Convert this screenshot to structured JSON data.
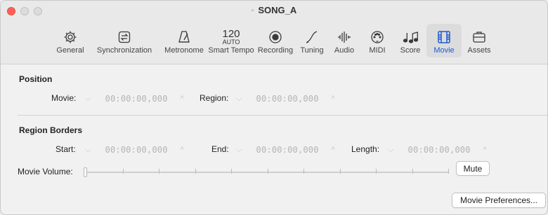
{
  "window": {
    "title": "SONG_A"
  },
  "tabs": [
    {
      "id": "general",
      "label": "General",
      "icon": "gear-icon"
    },
    {
      "id": "synchronization",
      "label": "Synchronization",
      "icon": "sync-icon"
    },
    {
      "id": "metronome",
      "label": "Metronome",
      "icon": "metronome-icon"
    },
    {
      "id": "smart-tempo",
      "label": "Smart Tempo",
      "icon_text_top": "120",
      "icon_text_mid": "AUTO"
    },
    {
      "id": "recording",
      "label": "Recording",
      "icon": "record-icon"
    },
    {
      "id": "tuning",
      "label": "Tuning",
      "icon": "tuning-icon"
    },
    {
      "id": "audio",
      "label": "Audio",
      "icon": "waveform-icon"
    },
    {
      "id": "midi",
      "label": "MIDI",
      "icon": "midi-icon"
    },
    {
      "id": "score",
      "label": "Score",
      "icon": "notes-icon"
    },
    {
      "id": "movie",
      "label": "Movie",
      "icon": "film-icon",
      "active": true
    },
    {
      "id": "assets",
      "label": "Assets",
      "icon": "briefcase-icon"
    }
  ],
  "position": {
    "title": "Position",
    "movie_label": "Movie:",
    "movie_value": "00:00:00,000",
    "region_label": "Region:",
    "region_value": "00:00:00,000"
  },
  "region_borders": {
    "title": "Region Borders",
    "start_label": "Start:",
    "start_value": "00:00:00,000",
    "end_label": "End:",
    "end_value": "00:00:00,000",
    "length_label": "Length:",
    "length_value": "00:00:00,000"
  },
  "movie_volume": {
    "label": "Movie Volume:",
    "level": 0,
    "mute_label": "Mute"
  },
  "footer": {
    "preferences_label": "Movie Preferences..."
  },
  "colors": {
    "accent": "#1f5bd6",
    "close": "#ff5f57"
  }
}
